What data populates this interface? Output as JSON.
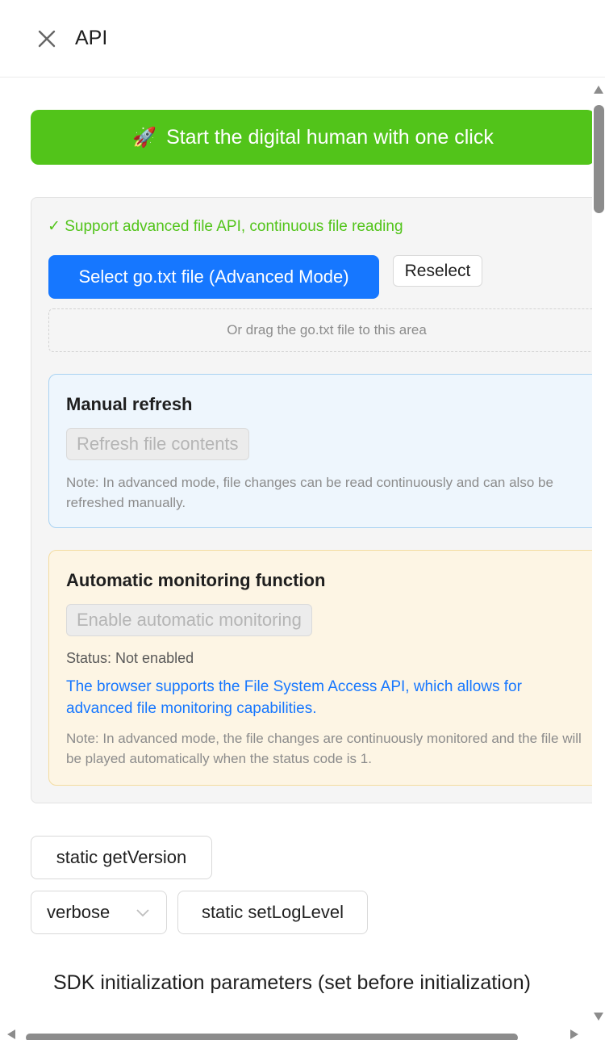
{
  "header": {
    "title": "API",
    "close_icon": "close-icon"
  },
  "cta": {
    "icon": "rocket-emoji",
    "label": "Start the digital human with one click",
    "color": "#52c41a"
  },
  "file_panel": {
    "support_text": "✓ Support advanced file API, continuous file reading",
    "select_button": "Select go.txt file (Advanced Mode)",
    "reselect_button": "Reselect",
    "dropzone_text": "Or drag the go.txt file to this area",
    "manual_refresh": {
      "title": "Manual refresh",
      "button": "Refresh file contents",
      "note": "Note: In advanced mode, file changes can be read continuously and can also be refreshed manually."
    },
    "auto_monitor": {
      "title": "Automatic monitoring function",
      "button": "Enable automatic monitoring",
      "status": "Status: Not enabled",
      "support_info": "The browser supports the File System Access API, which allows for advanced file monitoring capabilities.",
      "note": "Note: In advanced mode, the file changes are continuously monitored and the file will be played automatically when the status code is 1."
    }
  },
  "sdk": {
    "get_version_button": "static getVersion",
    "log_level_value": "verbose",
    "set_log_level_button": "static setLogLevel",
    "init_params_heading": "SDK initialization parameters (set before initialization)"
  },
  "colors": {
    "primary": "#1677ff",
    "success": "#52c41a"
  }
}
